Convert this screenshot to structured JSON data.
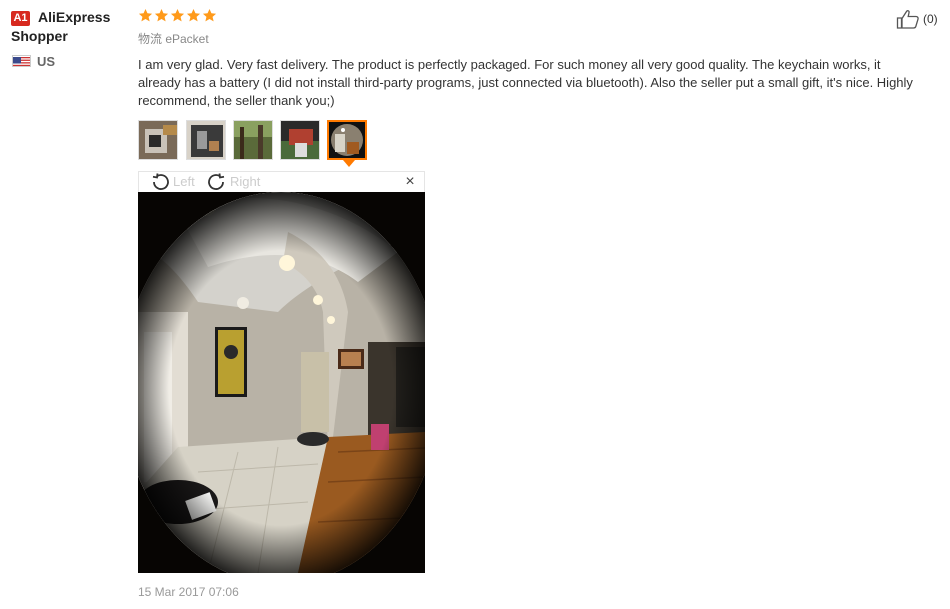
{
  "user": {
    "badge": "A1",
    "name": "AliExpress Shopper",
    "country": "US",
    "flag_icon": "us-flag-icon"
  },
  "review": {
    "rating_stars": 5,
    "star_color": "#ff9a1a",
    "logistics": "物流 ePacket",
    "text": "I am very glad. Very fast delivery. The product is perfectly packaged. For such money all very good quality. The keychain works, it already has a battery (I did not install third-party programs, just connected via bluetooth). Also the seller put a small gift, it's nice. Highly recommend, the seller thank you;)",
    "helpful_count": "(0)",
    "date": "15 Mar 2017 07:06"
  },
  "thumbnails": [
    {
      "name": "thumbnail-1",
      "active": false
    },
    {
      "name": "thumbnail-2",
      "active": false
    },
    {
      "name": "thumbnail-3",
      "active": false
    },
    {
      "name": "thumbnail-4",
      "active": false
    },
    {
      "name": "thumbnail-5",
      "active": true
    }
  ],
  "viewer": {
    "rotate_left_label": "Left",
    "rotate_right_label": "Right",
    "close_label": "×"
  },
  "colors": {
    "accent": "#ff7a00",
    "badge_red": "#d7291f"
  }
}
